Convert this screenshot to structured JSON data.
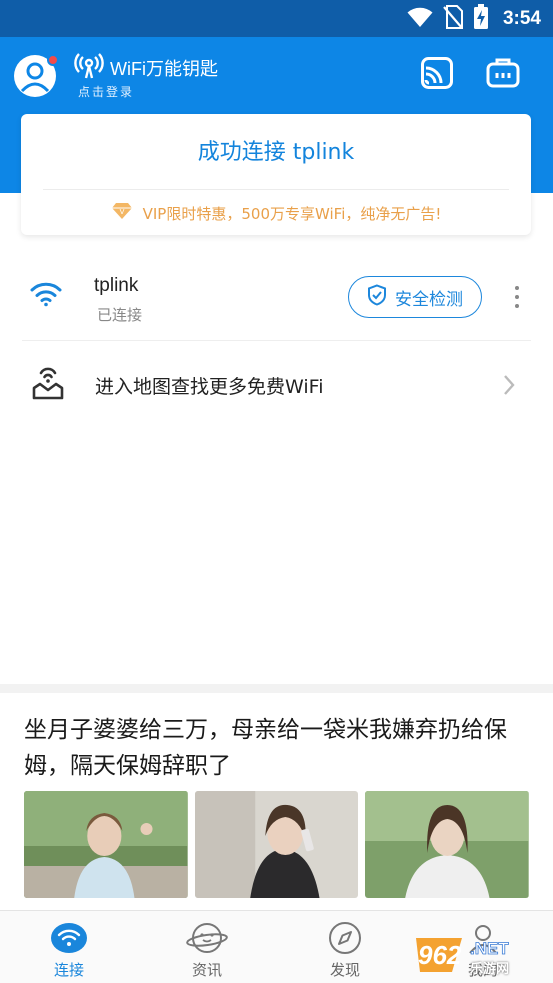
{
  "status_bar": {
    "time": "3:54"
  },
  "header": {
    "app_name": "WiFi万能钥匙",
    "login_hint": "点击登录",
    "icons": [
      "user-avatar-icon",
      "wifi-signal-icon",
      "cast-icon",
      "toolbox-icon"
    ]
  },
  "card": {
    "title": "成功连接 tplink",
    "promo": "VIP限时特惠，500万专享WiFi，纯净无广告!",
    "promo_color": "#e9a04a"
  },
  "network": {
    "ssid": "tplink",
    "status": "已连接",
    "security_button": "安全检测"
  },
  "map_entry": {
    "label": "进入地图查找更多免费WiFi"
  },
  "news": {
    "title": "坐月子婆婆给三万，母亲给一袋米我嫌弃扔给保姆，隔天保姆辞职了"
  },
  "bottom_nav": [
    {
      "label": "连接",
      "icon": "wifi-icon",
      "active": true
    },
    {
      "label": "资讯",
      "icon": "planet-icon",
      "active": false
    },
    {
      "label": "发现",
      "icon": "compass-icon",
      "active": false
    },
    {
      "label": "我的",
      "icon": "user-icon",
      "active": false
    }
  ],
  "watermark": {
    "text": "乐游网"
  },
  "colors": {
    "primary": "#0d86e6",
    "status_bar": "#0f5da8",
    "accent_blue": "#1a86db"
  }
}
